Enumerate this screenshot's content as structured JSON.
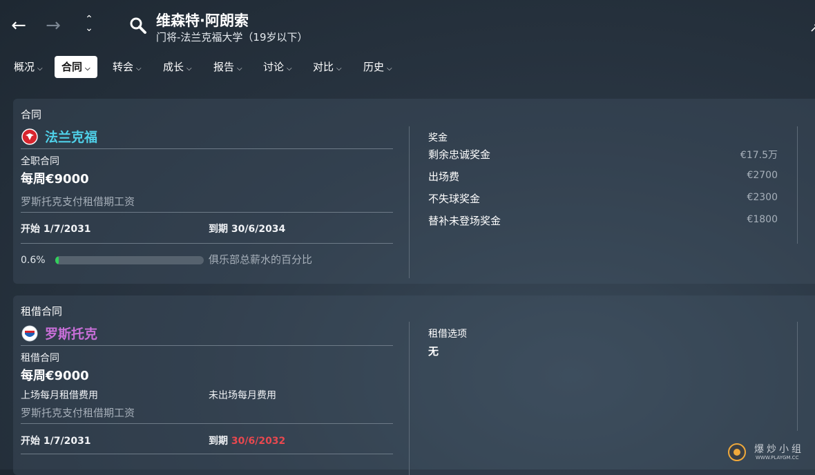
{
  "header": {
    "title": "维森特·阿朗索",
    "subtitle": "门将-法兰克福大学（19岁以下）"
  },
  "tabs": [
    {
      "label": "概况"
    },
    {
      "label": "合同"
    },
    {
      "label": "转会"
    },
    {
      "label": "成长"
    },
    {
      "label": "报告"
    },
    {
      "label": "讨论"
    },
    {
      "label": "对比"
    },
    {
      "label": "历史"
    }
  ],
  "contract": {
    "section_title": "合同",
    "club_name": "法兰克福",
    "club_color": "#4fd0e8",
    "type": "全职合同",
    "wage": "每周€9000",
    "note": "罗斯托克支付租借期工资",
    "start_label": "开始",
    "start": "1/7/2031",
    "end_label": "到期",
    "end": "30/6/2034",
    "wage_pct": "0.6%",
    "wage_pct_value": 0.006,
    "wage_pct_label": "俱乐部总薪水的百分比",
    "bonus_title": "奖金",
    "bonuses": [
      {
        "label": "剩余忠诚奖金",
        "value": "€17.5万"
      },
      {
        "label": "出场费",
        "value": "€2700"
      },
      {
        "label": "不失球奖金",
        "value": "€2300"
      },
      {
        "label": "替补未登场奖金",
        "value": "€1800"
      }
    ]
  },
  "loan": {
    "section_title": "租借合同",
    "club_name": "罗斯托克",
    "club_color": "#c86fd8",
    "type": "租借合同",
    "wage": "每周€9000",
    "fee_played_label": "上场每月租借费用",
    "fee_unused_label": "未出场每月费用",
    "note": "罗斯托克支付租借期工资",
    "start_label": "开始",
    "start": "1/7/2031",
    "end_label": "到期",
    "end": "30/6/2032",
    "end_color": "#e8484f",
    "options_title": "租借选项",
    "options_value": "无"
  },
  "watermark": {
    "text": "爆炒小组",
    "url": "WWW.PLAYGM.CC"
  }
}
